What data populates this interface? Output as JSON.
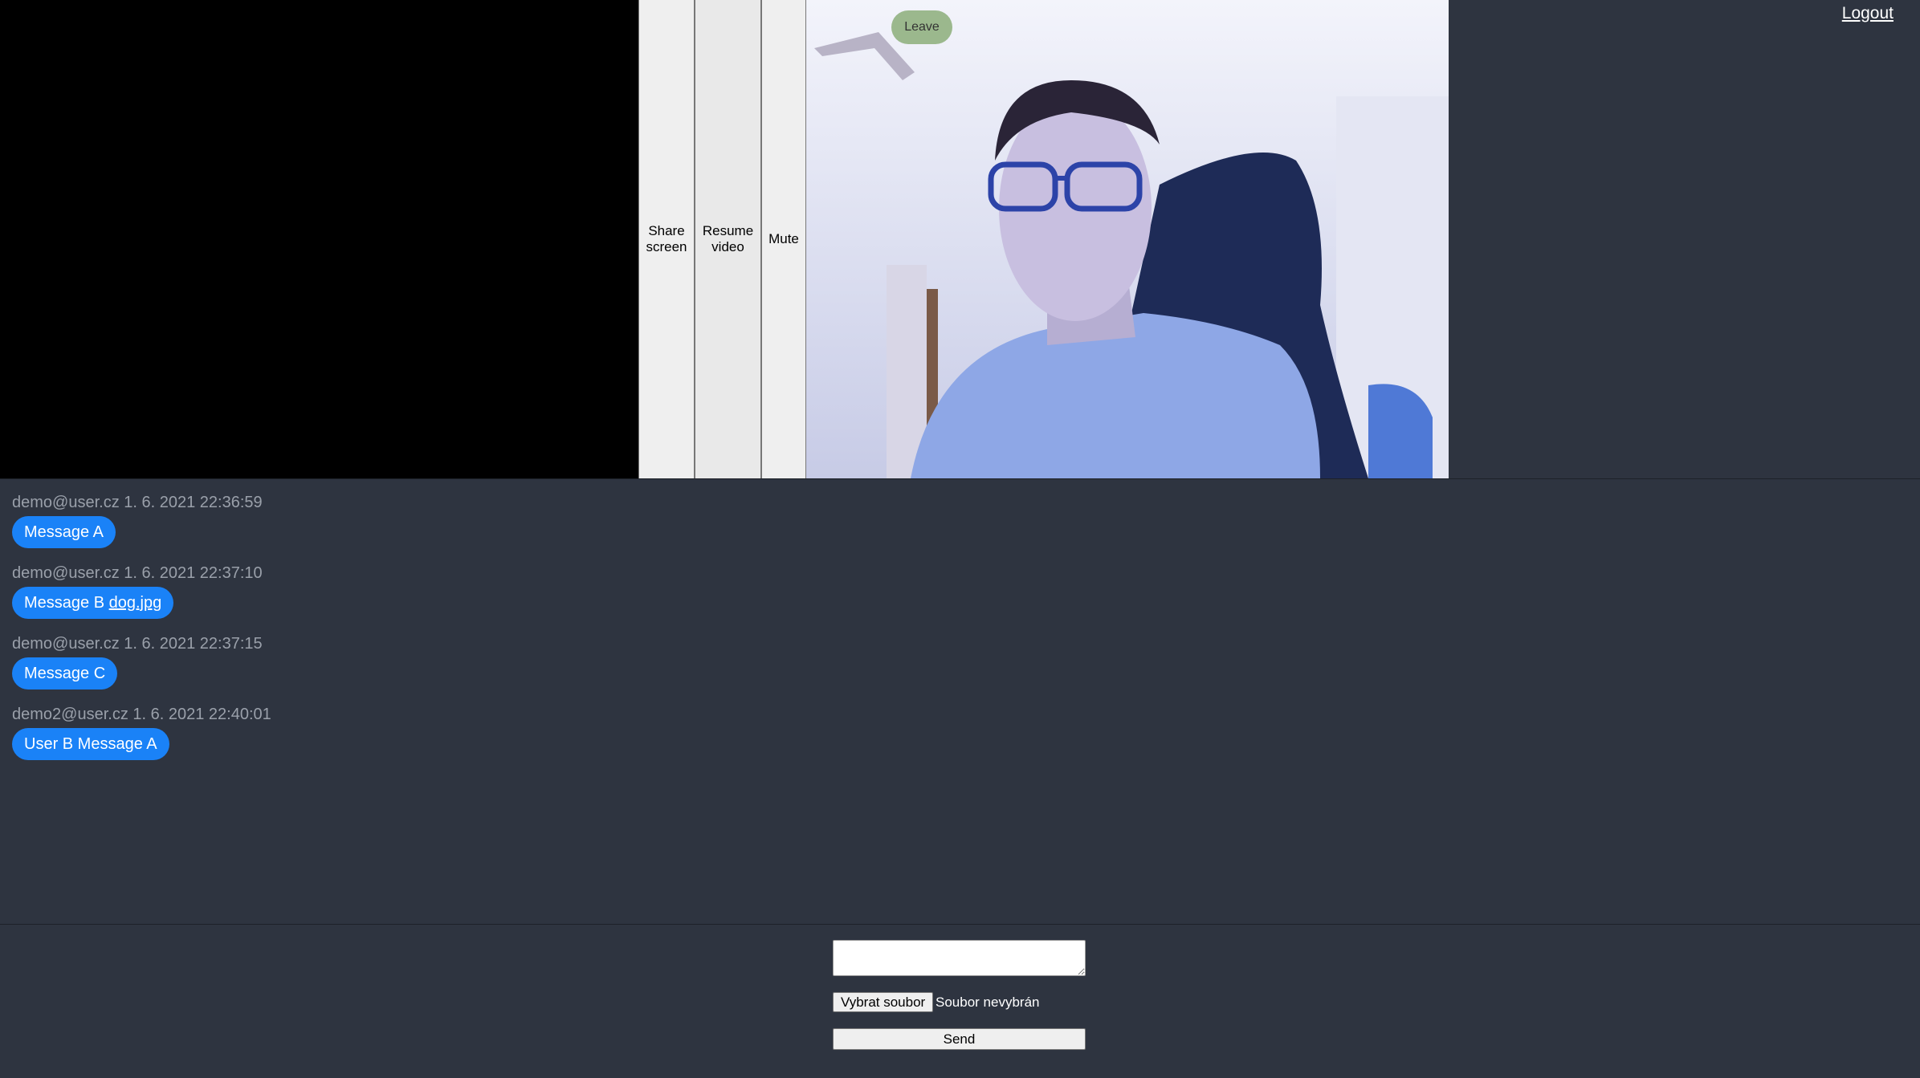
{
  "controls": {
    "share_screen": "Share screen",
    "resume_video": "Resume video",
    "mute": "Mute",
    "leave": "Leave",
    "logout": "Logout"
  },
  "messages": [
    {
      "author": "demo@user.cz",
      "timestamp": "1. 6. 2021 22:36:59",
      "text": "Message A",
      "attachment": null
    },
    {
      "author": "demo@user.cz",
      "timestamp": "1. 6. 2021 22:37:10",
      "text": "Message B",
      "attachment": "dog.jpg"
    },
    {
      "author": "demo@user.cz",
      "timestamp": "1. 6. 2021 22:37:15",
      "text": "Message C",
      "attachment": null
    },
    {
      "author": "demo2@user.cz",
      "timestamp": "1. 6. 2021 22:40:01",
      "text": "User B Message A",
      "attachment": null
    }
  ],
  "composer": {
    "input_value": "",
    "file_button": "Vybrat soubor",
    "file_status": "Soubor nevybrán",
    "send_label": "Send"
  },
  "colors": {
    "background": "#2e3440",
    "bubble": "#1a82f7",
    "leave_button": "#9bb88d"
  }
}
